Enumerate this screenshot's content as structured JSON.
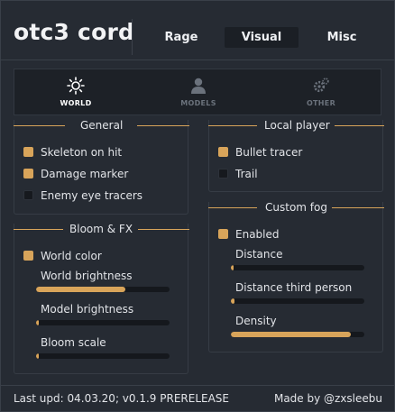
{
  "app": {
    "title": "otc3 cord"
  },
  "tabs": [
    {
      "label": "Rage",
      "active": false
    },
    {
      "label": "Visual",
      "active": true
    },
    {
      "label": "Misc",
      "active": false
    }
  ],
  "subtabs": [
    {
      "label": "WORLD",
      "icon": "sun-icon",
      "active": true
    },
    {
      "label": "MODELS",
      "icon": "person-icon",
      "active": false
    },
    {
      "label": "OTHER",
      "icon": "gears-icon",
      "active": false
    }
  ],
  "groups": {
    "general": {
      "title": "General",
      "options": [
        {
          "label": "Skeleton on hit",
          "checked": true
        },
        {
          "label": "Damage marker",
          "checked": true
        },
        {
          "label": "Enemy eye tracers",
          "checked": false
        }
      ]
    },
    "bloom": {
      "title": "Bloom & FX",
      "checkbox": {
        "label": "World color",
        "checked": true
      },
      "sliders": [
        {
          "label": "World brightness",
          "fraction": 0.67
        },
        {
          "label": "Model brightness",
          "fraction": 0.01
        },
        {
          "label": "Bloom scale",
          "fraction": 0.01
        }
      ]
    },
    "local_player": {
      "title": "Local player",
      "options": [
        {
          "label": "Bullet tracer",
          "checked": true
        },
        {
          "label": "Trail",
          "checked": false
        }
      ]
    },
    "custom_fog": {
      "title": "Custom fog",
      "checkbox": {
        "label": "Enabled",
        "checked": true
      },
      "sliders": [
        {
          "label": "Distance",
          "fraction": 0.01
        },
        {
          "label": "Distance third person",
          "fraction": 0.03
        },
        {
          "label": "Density",
          "fraction": 0.9
        }
      ]
    }
  },
  "footer": {
    "left": "Last upd: 04.03.20; v0.1.9 PRERELEASE",
    "right": "Made by @zxsleebu"
  },
  "colors": {
    "accent": "#d8a45a",
    "background": "#262b33",
    "panel": "#1d2127"
  }
}
